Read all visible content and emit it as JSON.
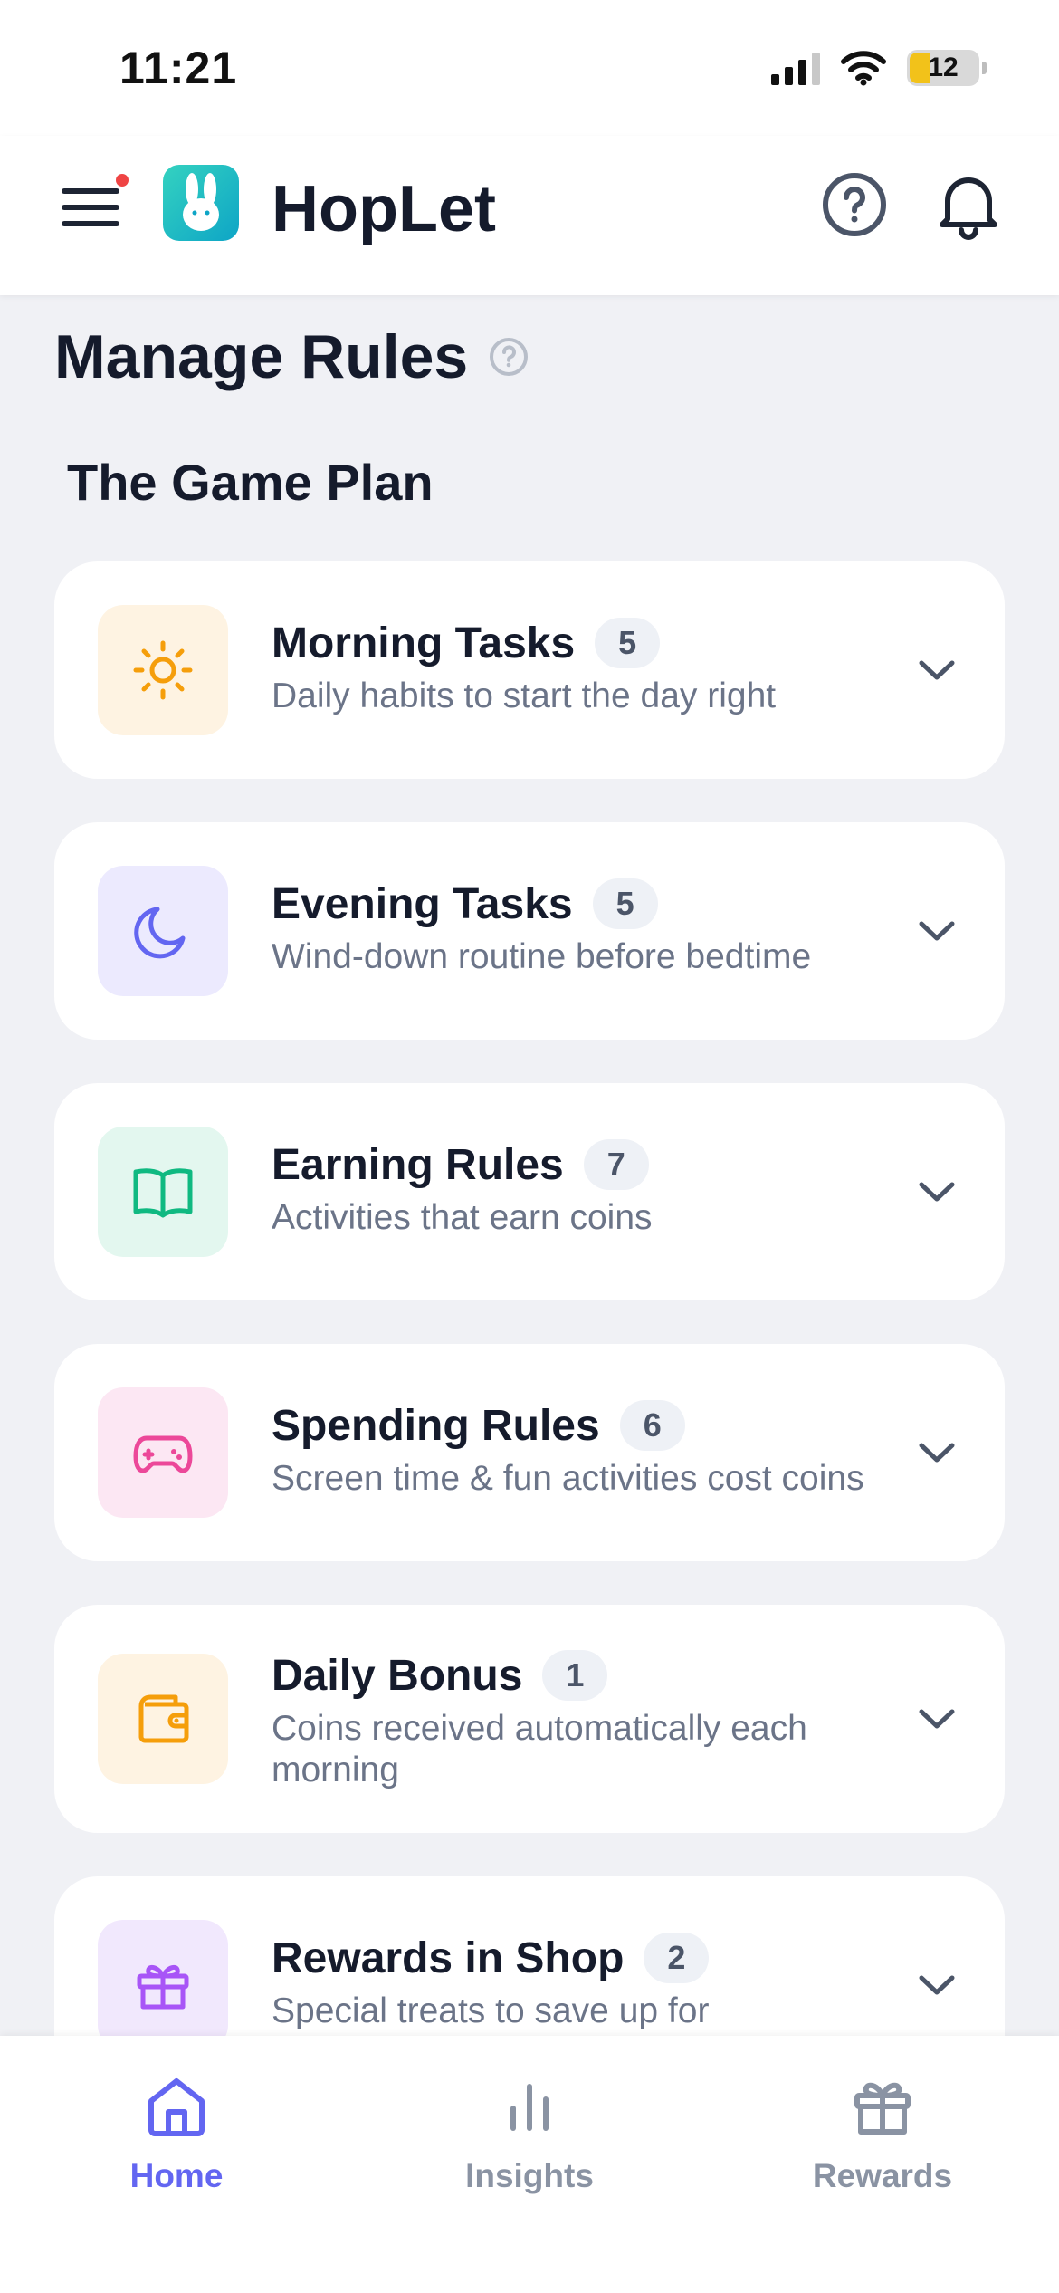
{
  "status_bar": {
    "time": "11:21",
    "battery": "12"
  },
  "header": {
    "app_name": "HopLet",
    "menu_icon": "hamburger-menu-icon",
    "help_icon": "help-circle-icon",
    "notification_icon": "bell-icon"
  },
  "page": {
    "title": "Manage Rules",
    "section_title": "The Game Plan"
  },
  "cards": [
    {
      "title": "Morning Tasks",
      "count": "5",
      "subtitle": "Daily habits to start the day right",
      "icon": "sun-icon",
      "icon_bg": "#fef3e2",
      "icon_color": "#f59e0b"
    },
    {
      "title": "Evening Tasks",
      "count": "5",
      "subtitle": "Wind-down routine before bedtime",
      "icon": "moon-icon",
      "icon_bg": "#eceafe",
      "icon_color": "#6366f1"
    },
    {
      "title": "Earning Rules",
      "count": "7",
      "subtitle": "Activities that earn coins",
      "icon": "book-icon",
      "icon_bg": "#e3f7ef",
      "icon_color": "#10b981"
    },
    {
      "title": "Spending Rules",
      "count": "6",
      "subtitle": "Screen time & fun activities cost coins",
      "icon": "gamepad-icon",
      "icon_bg": "#fce7f3",
      "icon_color": "#ec4899"
    },
    {
      "title": "Daily Bonus",
      "count": "1",
      "subtitle": "Coins received automatically each morning",
      "icon": "wallet-icon",
      "icon_bg": "#fef3e2",
      "icon_color": "#f59e0b"
    },
    {
      "title": "Rewards in Shop",
      "count": "2",
      "subtitle": "Special treats to save up for",
      "icon": "gift-icon",
      "icon_bg": "#f1e8fd",
      "icon_color": "#a855f7"
    }
  ],
  "tabs": [
    {
      "label": "Home",
      "icon": "home-icon",
      "active": true
    },
    {
      "label": "Insights",
      "icon": "bar-chart-icon",
      "active": false
    },
    {
      "label": "Rewards",
      "icon": "gift-icon",
      "active": false
    }
  ],
  "colors": {
    "accent": "#6366f1",
    "background": "#f0f1f5",
    "text": "#151b2c"
  }
}
